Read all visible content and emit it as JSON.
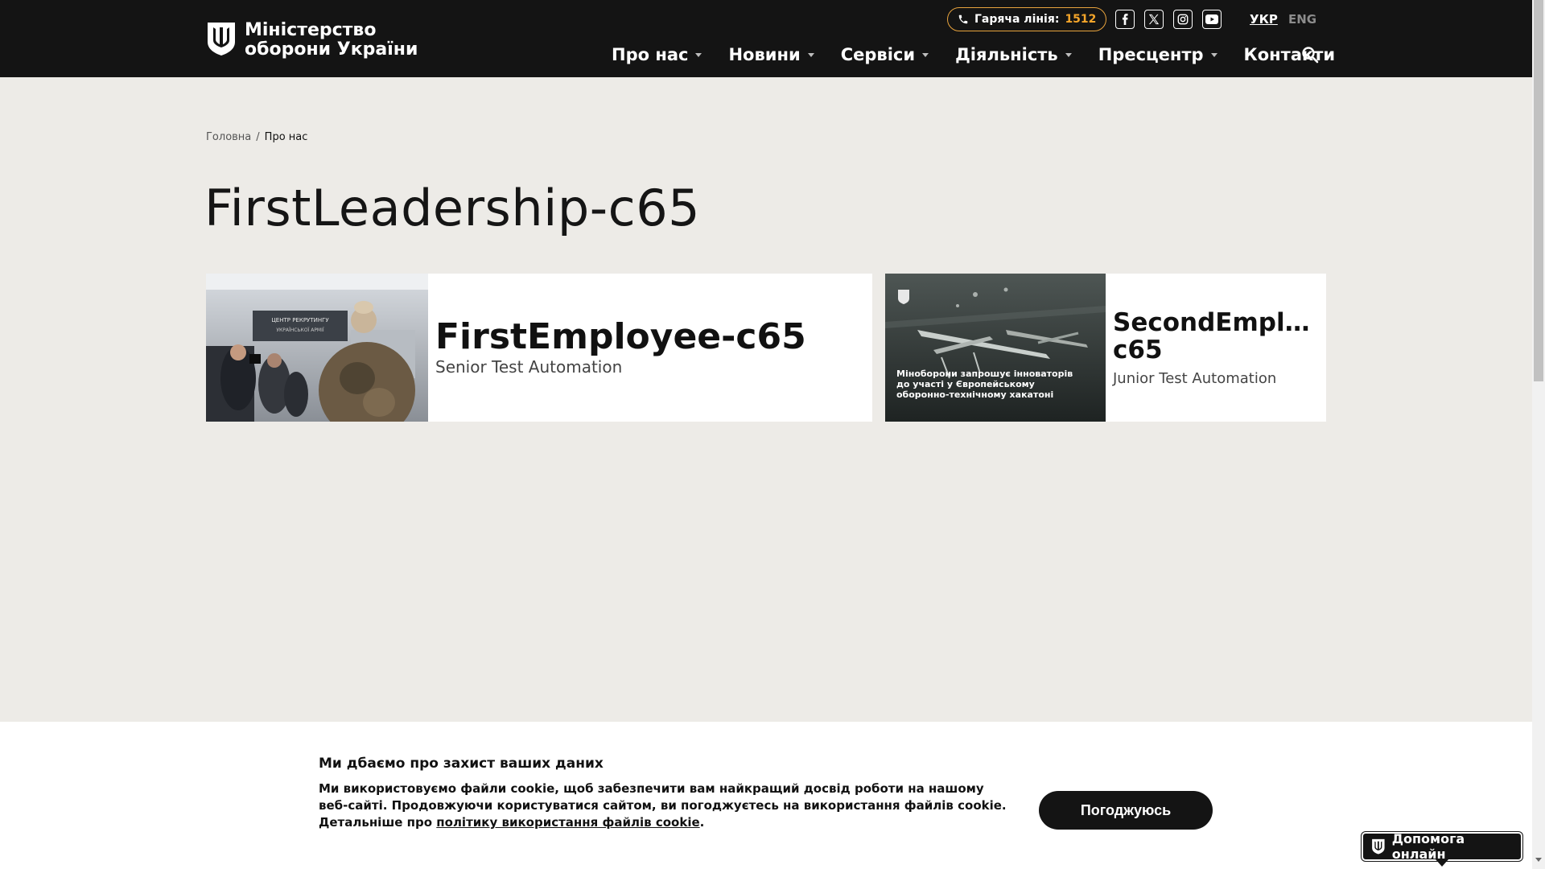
{
  "header": {
    "logo": {
      "line1": "Міністерство",
      "line2": "оборони України"
    },
    "hotline": {
      "label": "Гаряча лінія:",
      "number": "1512"
    },
    "socials": [
      "facebook-icon",
      "x-twitter-icon",
      "instagram-icon",
      "youtube-icon"
    ],
    "lang": {
      "ukr": "УКР",
      "eng": "ENG"
    },
    "nav": [
      {
        "label": "Про нас",
        "dropdown": true
      },
      {
        "label": "Новини",
        "dropdown": true
      },
      {
        "label": "Сервіси",
        "dropdown": true
      },
      {
        "label": "Діяльність",
        "dropdown": true
      },
      {
        "label": "Пресцентр",
        "dropdown": true
      },
      {
        "label": "Контакти",
        "dropdown": false
      }
    ]
  },
  "breadcrumb": {
    "home": "Головна",
    "separator": "/",
    "current": "Про нас"
  },
  "page": {
    "title": "FirstLeadership-c65"
  },
  "cards": [
    {
      "name": "FirstEmployee-c65",
      "role": "Senior Test Automation",
      "photo_caption": "ЦЕНТР РЕКРУТИНГУ",
      "photo_subcaption": "УКРАЇНСЬКОЇ АРМІЇ"
    },
    {
      "name_line1": "SecondEmploy...",
      "name_line2": "c65",
      "role": "Junior Test Automation",
      "photo_text": [
        "Міноборони запрошує інноваторів",
        "до участі у Європейському",
        "оборонно-технічному хакатоні"
      ]
    }
  ],
  "cookie": {
    "title": "Ми дбаємо про захист ваших даних",
    "text": "Ми використовуємо файли cookie, щоб забезпечити вам найкращий досвід роботи на нашому веб-сайті. Продовжуючи користуватися сайтом, ви погоджуєтесь на використання файлів cookie. Детальніше про ",
    "link": "політику використання файлів cookie",
    "text_end": ".",
    "agree": "Погоджуюсь"
  },
  "help": {
    "label": "Допомога онлайн"
  },
  "colors": {
    "header_bg": "#141414",
    "page_bg": "#edebe7",
    "accent": "#f4a52a"
  }
}
